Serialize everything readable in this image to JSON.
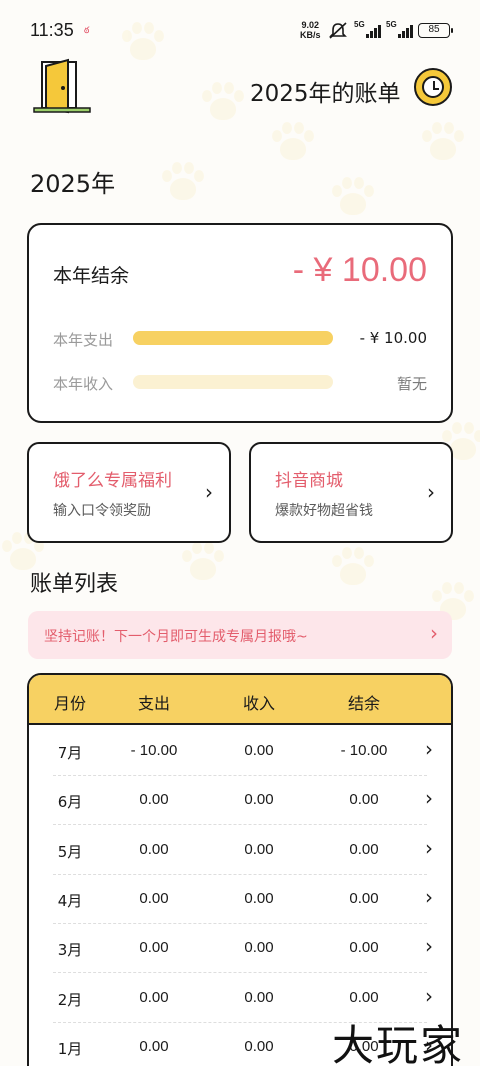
{
  "status_bar": {
    "time": "11:35",
    "net_speed_value": "9.02",
    "net_speed_unit": "KB/s",
    "signal1_tag": "5G",
    "signal2_tag": "5G",
    "battery": "85"
  },
  "header": {
    "title": "2025年的账单",
    "left_icon": "door-icon",
    "right_icon": "clock-icon"
  },
  "year_title": "2025年",
  "summary": {
    "balance_label": "本年结余",
    "balance_amount": "- ¥ 10.00",
    "expense_label": "本年支出",
    "expense_value": "- ¥ 10.00",
    "expense_fill": 1.0,
    "income_label": "本年收入",
    "income_value": "暂无",
    "income_fill": 0.0
  },
  "promos": [
    {
      "title": "饿了么专属福利",
      "subtitle": "输入口令领奖励"
    },
    {
      "title": "抖音商城",
      "subtitle": "爆款好物超省钱"
    }
  ],
  "bill_list": {
    "title": "账单列表",
    "tip": "坚持记账！下一个月即可生成专属月报哦~",
    "columns": [
      "月份",
      "支出",
      "收入",
      "结余"
    ],
    "rows": [
      [
        "7月",
        "- 10.00",
        "0.00",
        "- 10.00"
      ],
      [
        "6月",
        "0.00",
        "0.00",
        "0.00"
      ],
      [
        "5月",
        "0.00",
        "0.00",
        "0.00"
      ],
      [
        "4月",
        "0.00",
        "0.00",
        "0.00"
      ],
      [
        "3月",
        "0.00",
        "0.00",
        "0.00"
      ],
      [
        "2月",
        "0.00",
        "0.00",
        "0.00"
      ],
      [
        "1月",
        "0.00",
        "0.00",
        "0.00"
      ]
    ]
  },
  "watermark": "大玩家",
  "colors": {
    "accent_yellow": "#f7d162",
    "accent_pink": "#e96b7a",
    "tip_bg": "#fde6ea"
  }
}
